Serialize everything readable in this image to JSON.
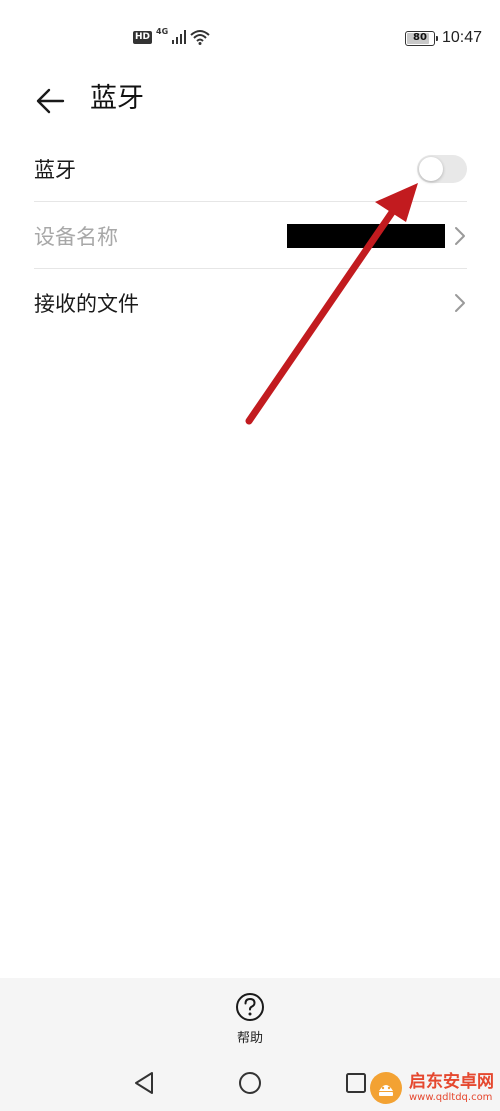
{
  "status_bar": {
    "hd_badge": "HD",
    "network": "4G",
    "battery_level": "80",
    "time": "10:47",
    "icons": [
      "hd-icon",
      "signal-icon",
      "wifi-icon",
      "battery-icon"
    ]
  },
  "header": {
    "title": "蓝牙",
    "back_icon": "arrow-left-icon"
  },
  "settings": {
    "bluetooth": {
      "label": "蓝牙",
      "enabled": false
    },
    "device_name": {
      "label": "设备名称",
      "value": "[redacted]",
      "disabled": true
    },
    "received_files": {
      "label": "接收的文件"
    }
  },
  "bottom": {
    "help_label": "帮助",
    "help_icon": "question-circle-icon"
  },
  "navbar": {
    "icons": [
      "nav-back-icon",
      "nav-home-icon",
      "nav-recents-icon"
    ]
  },
  "annotation": {
    "color": "#c21b1f",
    "points_to": "bluetooth-toggle"
  },
  "watermark": {
    "name": "启东安卓网",
    "url": "www.qdltdq.com",
    "accent_color": "#e5482f"
  }
}
